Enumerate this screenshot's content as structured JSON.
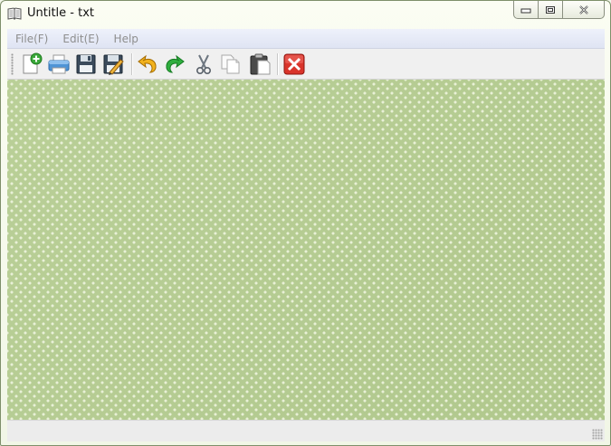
{
  "window": {
    "title": "Untitle - txt"
  },
  "menu": {
    "items": [
      "File(F)",
      "Edit(E)",
      "Help"
    ]
  },
  "toolbar": {
    "buttons": [
      "new-file-icon",
      "print-icon",
      "save-icon",
      "save-as-icon",
      "undo-icon",
      "redo-icon",
      "cut-icon",
      "copy-icon",
      "paste-icon",
      "close-document-icon"
    ]
  },
  "colors": {
    "editor_background": "#b6cd92",
    "menu_text_disabled": "#8e8e8e",
    "close_button": "#d9342b"
  }
}
